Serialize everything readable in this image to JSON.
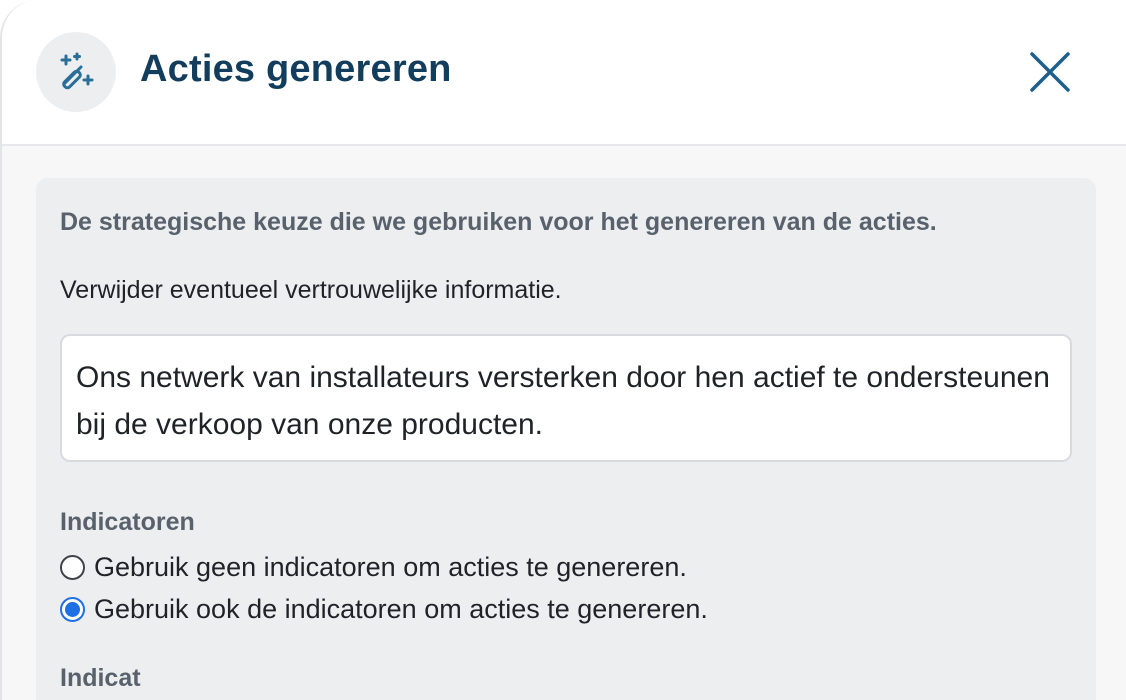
{
  "dialog": {
    "title": "Acties genereren",
    "icon": "magic-wand-icon",
    "close_icon": "close-icon"
  },
  "strategy": {
    "heading": "De strategische keuze die we gebruiken voor het genereren van de acties.",
    "note": "Verwijder eventueel vertrouwelijke informatie.",
    "text_value": "Ons netwerk van installateurs versterken door hen actief te ondersteunen bij de verkoop van onze producten."
  },
  "indicators": {
    "label": "Indicatoren",
    "options": [
      {
        "label": "Gebruik geen indicatoren om acties te genereren.",
        "selected": false
      },
      {
        "label": "Gebruik ook de indicatoren om acties te genereren.",
        "selected": true
      }
    ],
    "next_label_partial": "Indicat"
  },
  "colors": {
    "title": "#123d5c",
    "accent": "#1f6fe5",
    "panel": "#eceef0"
  }
}
